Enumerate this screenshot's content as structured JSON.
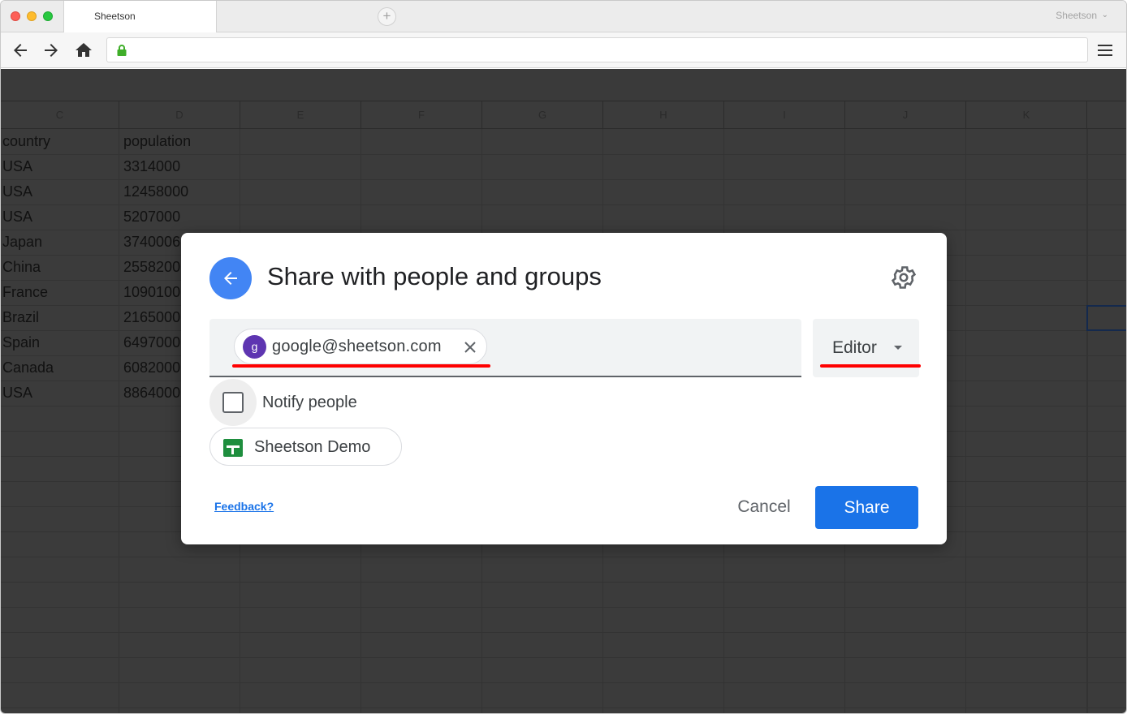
{
  "browser": {
    "tab_title": "Sheetson",
    "new_tab_symbol": "+",
    "profile_name": "Sheetson",
    "profile_chevron": "⌄",
    "url": ""
  },
  "sheet": {
    "columns": [
      "C",
      "D",
      "E",
      "F",
      "G",
      "H",
      "I",
      "J",
      "K"
    ],
    "rows": [
      {
        "country": "country",
        "population": "population"
      },
      {
        "country": "USA",
        "population": "3314000"
      },
      {
        "country": "USA",
        "population": "12458000"
      },
      {
        "country": "USA",
        "population": "5207000"
      },
      {
        "country": "Japan",
        "population": "3740006"
      },
      {
        "country": "China",
        "population": "2558200"
      },
      {
        "country": "France",
        "population": "1090100"
      },
      {
        "country": "Brazil",
        "population": "2165000"
      },
      {
        "country": "Spain",
        "population": "6497000"
      },
      {
        "country": "Canada",
        "population": "6082000"
      },
      {
        "country": "USA",
        "population": "8864000"
      }
    ]
  },
  "dialog": {
    "title": "Share with people and groups",
    "recipient": {
      "avatar_letter": "g",
      "email": "google@sheetson.com"
    },
    "role": "Editor",
    "notify_label": "Notify people",
    "notify_checked": false,
    "file_name": "Sheetson Demo",
    "feedback_label": "Feedback?",
    "cancel_label": "Cancel",
    "share_label": "Share"
  },
  "colors": {
    "accent": "#1a73e8",
    "back_button": "#4285f4",
    "avatar": "#5e35b1",
    "highlight": "#ff0000",
    "overlay": "#3b3b3b"
  },
  "icons": [
    "back-arrow-icon",
    "forward-arrow-icon",
    "home-icon",
    "lock-icon",
    "hamburger-menu-icon",
    "arrow-left-icon",
    "gear-icon",
    "close-icon",
    "dropdown-caret-icon",
    "sheets-file-icon"
  ]
}
